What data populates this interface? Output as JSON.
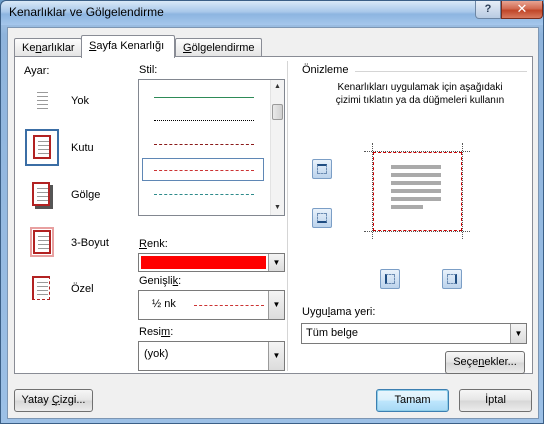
{
  "window": {
    "title": "Kenarlıklar ve Gölgelendirme",
    "help": "?",
    "close": "✕"
  },
  "tabs": [
    {
      "label": "Kenarlıklar",
      "accel": "n"
    },
    {
      "label": "Sayfa Kenarlığı",
      "accel": "S",
      "active": true
    },
    {
      "label": "Gölgelendirme",
      "accel": "G"
    }
  ],
  "settings": {
    "heading": "Ayar:",
    "items": [
      {
        "label": "Yok",
        "icon": "none-border-icon"
      },
      {
        "label": "Kutu",
        "icon": "box-border-icon",
        "selected": true
      },
      {
        "label": "Gölge",
        "icon": "shadow-border-icon"
      },
      {
        "label": "3-Boyut",
        "icon": "3d-border-icon"
      },
      {
        "label": "Özel",
        "icon": "custom-border-icon"
      }
    ]
  },
  "style": {
    "heading": "Stil:",
    "lines": [
      {
        "kind": "solid",
        "color": "#2e8b57"
      },
      {
        "kind": "dotted",
        "color": "#000000"
      },
      {
        "kind": "dashed",
        "color": "#8b1a1a"
      },
      {
        "kind": "dashed",
        "color": "#cc3333",
        "selected": true
      },
      {
        "kind": "dashdot",
        "color": "#2e8b8b"
      }
    ]
  },
  "color": {
    "label": "Renk:",
    "value_color": "#ff0000"
  },
  "width": {
    "label": "Genişlik:",
    "value": "½ nk"
  },
  "art": {
    "label": "Resim:",
    "value": "(yok)"
  },
  "preview": {
    "heading": "Önizleme",
    "instructions": "Kenarlıkları uygulamak için aşağıdaki çizimi tıklatın ya da düğmeleri kullanın",
    "border_color": "#cc0000"
  },
  "apply_to": {
    "label": "Uygulama yeri:",
    "value": "Tüm belge"
  },
  "buttons": {
    "options": "Seçenekler...",
    "horizontal_line": "Yatay Çizgi...",
    "ok": "Tamam",
    "cancel": "İptal"
  }
}
